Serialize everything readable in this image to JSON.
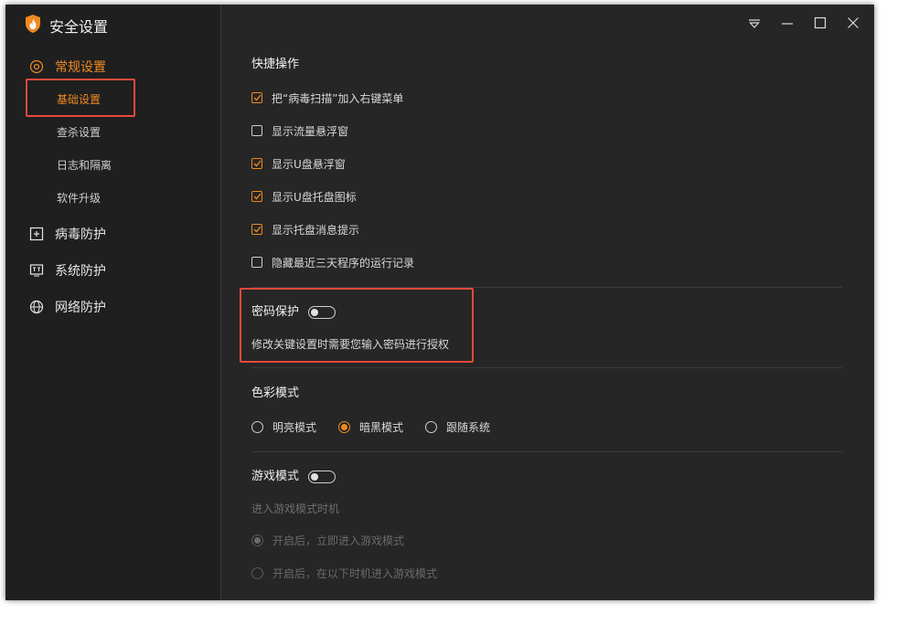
{
  "app": {
    "title": "安全设置",
    "icon": "shield-flame-icon"
  },
  "sidebar": {
    "groups": [
      {
        "label": "常规设置",
        "icon": "gear-icon",
        "active": true,
        "items": [
          {
            "label": "基础设置",
            "active": true
          },
          {
            "label": "查杀设置"
          },
          {
            "label": "日志和隔离"
          },
          {
            "label": "软件升级"
          }
        ]
      },
      {
        "label": "病毒防护",
        "icon": "plus-square-icon"
      },
      {
        "label": "系统防护",
        "icon": "monitor-icon"
      },
      {
        "label": "网络防护",
        "icon": "globe-icon"
      }
    ]
  },
  "titlebar": {
    "buttons": [
      "menu-icon",
      "minimize-icon",
      "maximize-icon",
      "close-icon"
    ]
  },
  "quick_ops": {
    "title": "快捷操作",
    "options": [
      {
        "label": "把“病毒扫描”加入右键菜单",
        "checked": true
      },
      {
        "label": "显示流量悬浮窗",
        "checked": false
      },
      {
        "label": "显示U盘悬浮窗",
        "checked": true
      },
      {
        "label": "显示U盘托盘图标",
        "checked": true
      },
      {
        "label": "显示托盘消息提示",
        "checked": true
      },
      {
        "label": "隐藏最近三天程序的运行记录",
        "checked": false
      }
    ]
  },
  "password": {
    "title": "密码保护",
    "enabled": false,
    "description": "修改关键设置时需要您输入密码进行授权"
  },
  "color_mode": {
    "title": "色彩模式",
    "options": [
      {
        "label": "明亮模式",
        "selected": false
      },
      {
        "label": "暗黑模式",
        "selected": true
      },
      {
        "label": "跟随系统",
        "selected": false
      }
    ]
  },
  "game_mode": {
    "title": "游戏模式",
    "enabled": false,
    "subtitle": "进入游戏模式时机",
    "options": [
      {
        "label": "开启后，立即进入游戏模式",
        "selected": true
      },
      {
        "label": "开启后，在以下时机进入游戏模式",
        "selected": false
      }
    ]
  },
  "colors": {
    "accent": "#f08a22",
    "highlight": "#e64a3b",
    "bg": "#262626",
    "sidebar": "#1f1f1f"
  }
}
